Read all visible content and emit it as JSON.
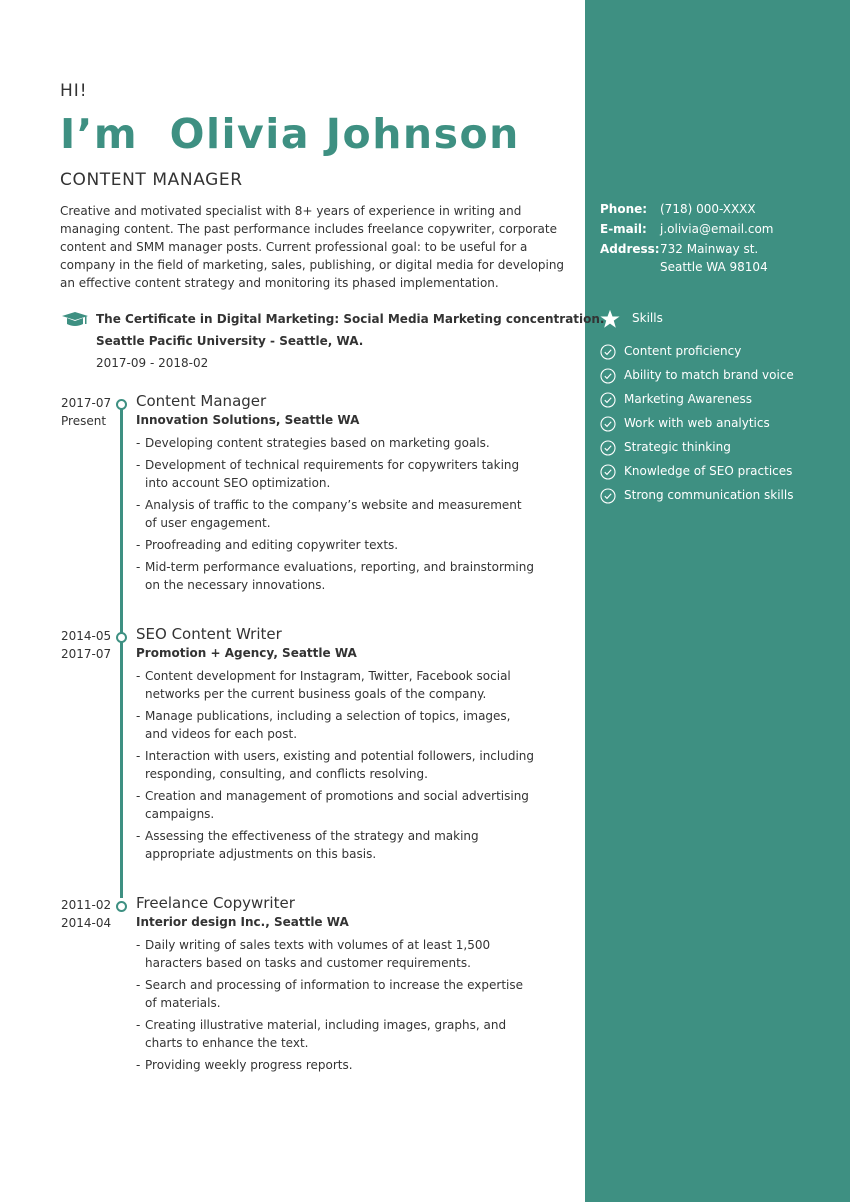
{
  "header": {
    "greeting": "HI!",
    "name": "I’m  Olivia Johnson",
    "role": "CONTENT MANAGER",
    "summary": "Creative and motivated specialist with 8+ years of experience in writing and managing content. The past performance includes freelance copywriter, corporate content and SMM manager posts.  Current professional goal: to be useful for a company in the field of marketing, sales, publishing, or digital media for developing an effective content strategy and monitoring its phased implementation."
  },
  "education": {
    "icon": "graduation-cap-icon",
    "title": "The Certificate in Digital Marketing: Social Media Marketing concentration.",
    "school": "Seattle Pacific University - Seattle, WA.",
    "dates": "2017-09 - 2018-02"
  },
  "experience": [
    {
      "start": "2017-07",
      "end": "Present",
      "title": "Content Manager",
      "company": "Innovation Solutions, Seattle WA",
      "bullets": [
        "Developing content strategies based on marketing goals.",
        "Development of technical requirements for copywriters taking into account SEO optimization.",
        "Analysis of traffic to the company’s website and measurement of user engagement.",
        "Proofreading and editing copywriter texts.",
        "Mid-term performance evaluations, reporting, and brainstorming on the necessary innovations."
      ]
    },
    {
      "start": "2014-05",
      "end": "2017-07",
      "title": "SEO Content Writer",
      "company": "Promotion + Agency, Seattle WA",
      "bullets": [
        "Content development for Instagram, Twitter, Facebook social networks per the current business goals of the company.",
        "Manage publications, including a selection of topics, images, and videos for each post.",
        "Interaction with users, existing and potential followers, including responding, consulting, and conflicts resolving.",
        "Creation and management of promotions and social advertising campaigns.",
        "Assessing the effectiveness of the strategy and making appropriate adjustments on this basis."
      ]
    },
    {
      "start": "2011-02",
      "end": "2014-04",
      "title": "Freelance Copywriter",
      "company": "Interior design Inc., Seattle WA",
      "bullets": [
        "Daily writing of sales texts with volumes of at least 1,500 haracters based on tasks and customer requirements.",
        "Search and processing of information to increase the expertise of materials.",
        "Creating illustrative material, including images, graphs, and charts to enhance the text.",
        "Providing weekly progress reports."
      ]
    }
  ],
  "contact": {
    "phone_label": "Phone:",
    "phone": "(718) 000-XXXX",
    "email_label": "E-mail:",
    "email": "j.olivia@email.com",
    "address_label": "Address:",
    "address_line1": "732 Mainway st.",
    "address_line2": "Seattle WA 98104"
  },
  "skills": {
    "heading": "Skills",
    "icon": "star-icon",
    "items": [
      "Content proficiency",
      "Ability to match brand voice",
      "Marketing Awareness",
      "Work with web analytics",
      "Strategic thinking",
      "Knowledge of SEO practices",
      "Strong communication skills"
    ]
  },
  "colors": {
    "accent": "#3e9082",
    "text": "#333333",
    "sidebar_text": "#ffffff"
  }
}
